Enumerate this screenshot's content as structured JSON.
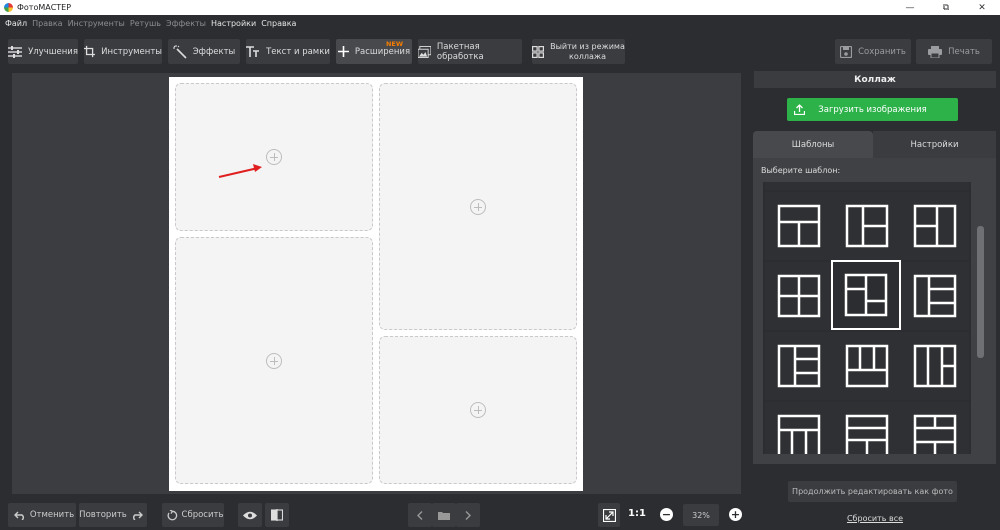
{
  "app": {
    "title": "ФотоМАСТЕР"
  },
  "menu": [
    {
      "label": "Файл",
      "enabled": true
    },
    {
      "label": "Правка",
      "enabled": false
    },
    {
      "label": "Инструменты",
      "enabled": false
    },
    {
      "label": "Ретушь",
      "enabled": false
    },
    {
      "label": "Эффекты",
      "enabled": false
    },
    {
      "label": "Настройки",
      "enabled": true
    },
    {
      "label": "Справка",
      "enabled": true
    }
  ],
  "toolbar": {
    "enhance": "Улучшения",
    "tools": "Инструменты",
    "effects": "Эффекты",
    "text": "Текст и рамки",
    "extensions": "Расширения",
    "new_badge": "NEW",
    "batch": "Пакетная обработка",
    "exit_line1": "Выйти из режима",
    "exit_line2": "коллажа",
    "save": "Сохранить",
    "print": "Печать"
  },
  "bottom": {
    "undo": "Отменить",
    "redo": "Повторить",
    "reset": "Сбросить",
    "one_to_one": "1:1",
    "zoom": "32%"
  },
  "panel": {
    "title": "Коллаж",
    "upload": "Загрузить изображения",
    "tabs": [
      "Шаблоны",
      "Настройки"
    ],
    "choose_label": "Выберите шаблон:",
    "continue": "Продолжить редактировать как фото",
    "reset_all": "Сбросить все"
  },
  "icons": {
    "titlebar": [
      "minimize-icon",
      "restore-icon",
      "close-icon"
    ],
    "toolbar": [
      "sliders-icon",
      "crop-icon",
      "magic-wand-icon",
      "text-icon",
      "plus-icon",
      "image-stack-icon",
      "grid-icon",
      "save-disk-icon",
      "printer-icon"
    ],
    "bottom": [
      "undo-icon",
      "redo-icon",
      "reset-icon",
      "eye-icon",
      "compare-icon",
      "prev-icon",
      "folder-icon",
      "next-icon",
      "fit-screen-icon",
      "zoom-out-icon",
      "zoom-in-icon"
    ]
  },
  "colors": {
    "accent_green": "#2db24a",
    "new_badge": "#f57c00",
    "annotation_arrow": "#e02020"
  }
}
